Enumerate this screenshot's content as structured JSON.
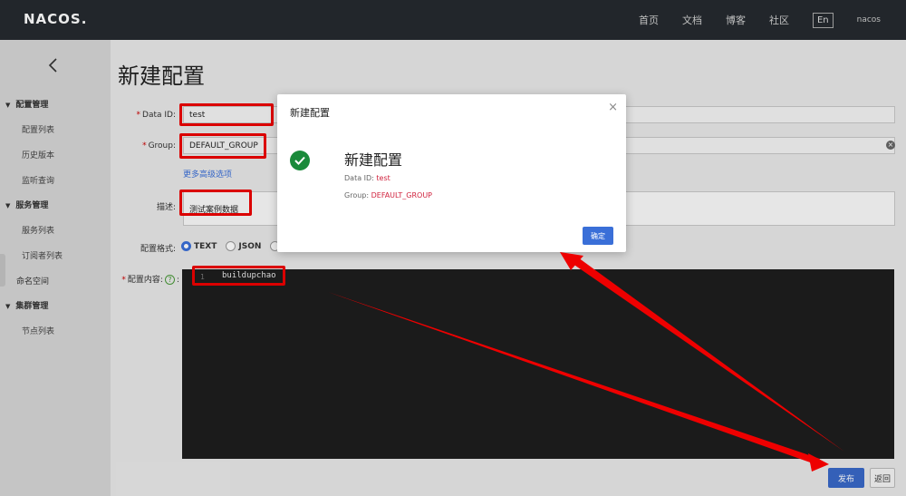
{
  "header": {
    "logo": "NACOS.",
    "nav": [
      "首页",
      "文档",
      "博客",
      "社区"
    ],
    "lang": "En",
    "user": "nacos"
  },
  "sidebar": {
    "back_icon": "chevron-left-icon",
    "group_config": "配置管理",
    "item_config_list": "配置列表",
    "item_history": "历史版本",
    "item_listen": "监听查询",
    "group_service": "服务管理",
    "item_service_list": "服务列表",
    "item_subscriber": "订阅者列表",
    "item_namespace": "命名空间",
    "group_cluster": "集群管理",
    "item_nodes": "节点列表"
  },
  "form": {
    "page_title": "新建配置",
    "data_id_label": "Data ID:",
    "data_id_value": "test",
    "group_label": "Group:",
    "group_value": "DEFAULT_GROUP",
    "advanced_link": "更多高级选项",
    "desc_label": "描述:",
    "desc_value": "测试案例数据",
    "format_label": "配置格式:",
    "format_options": [
      "TEXT",
      "JSON"
    ],
    "selected_format": "TEXT",
    "content_label": "配置内容:",
    "help_icon_glyph": "?",
    "line_number": "1",
    "content_value": "buildupchao",
    "publish_label": "发布",
    "back_label": "返回"
  },
  "dialog": {
    "title": "新建配置",
    "close_glyph": "×",
    "heading": "新建配置",
    "data_id_label": "Data ID:",
    "data_id_value": "test",
    "group_label": "Group:",
    "group_value": "DEFAULT_GROUP",
    "ok_label": "确定",
    "success_icon": "check-circle-icon"
  },
  "colors": {
    "annotation": "#e00000",
    "primary": "#3a6fd8",
    "success": "#1a8a3a",
    "topbar": "#252a2f"
  }
}
